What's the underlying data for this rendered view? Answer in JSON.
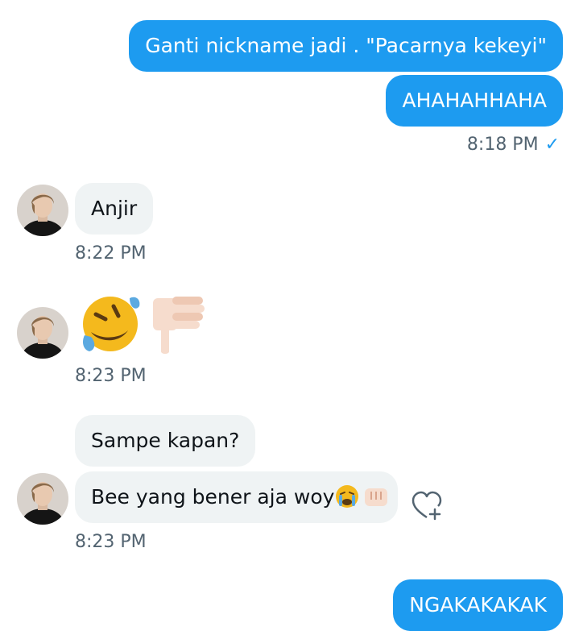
{
  "messages": {
    "out1": "Ganti nickname jadi . \"Pacarnya kekeyi\"",
    "out2": "AHAHAHHAHA",
    "out_time": "8:18 PM",
    "in1": "Anjir",
    "in1_time": "8:22 PM",
    "emoji_time": "8:23 PM",
    "in2": "Sampe kapan?",
    "in3": "Bee yang bener aja woy",
    "in3_time": "8:23 PM",
    "out3": "NGAKAKAKAK"
  },
  "icons": {
    "read_check": "checkmark-icon",
    "react": "heart-plus-icon",
    "emoji_laugh": "rolling-on-floor-laughing",
    "emoji_thumb": "thumbs-down",
    "emoji_cry": "loudly-crying-face",
    "emoji_fist": "oncoming-fist"
  },
  "colors": {
    "outgoing_bubble": "#1d9bf0",
    "incoming_bubble": "#eff3f4",
    "timestamp": "#536471"
  }
}
